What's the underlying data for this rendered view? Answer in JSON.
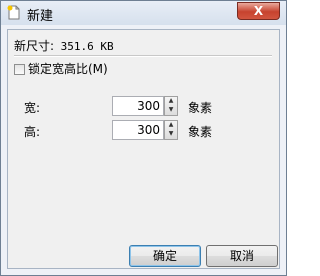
{
  "window": {
    "title": "新建",
    "close_glyph": "X"
  },
  "info": {
    "size_label": "新尺寸:",
    "size_value": "351.6 KB"
  },
  "lock_ratio": {
    "label": "锁定宽高比(M)",
    "checked": false
  },
  "width": {
    "label": "宽:",
    "value": "300",
    "unit": "象素"
  },
  "height": {
    "label": "高:",
    "value": "300",
    "unit": "象素"
  },
  "buttons": {
    "ok": "确定",
    "cancel": "取消"
  }
}
